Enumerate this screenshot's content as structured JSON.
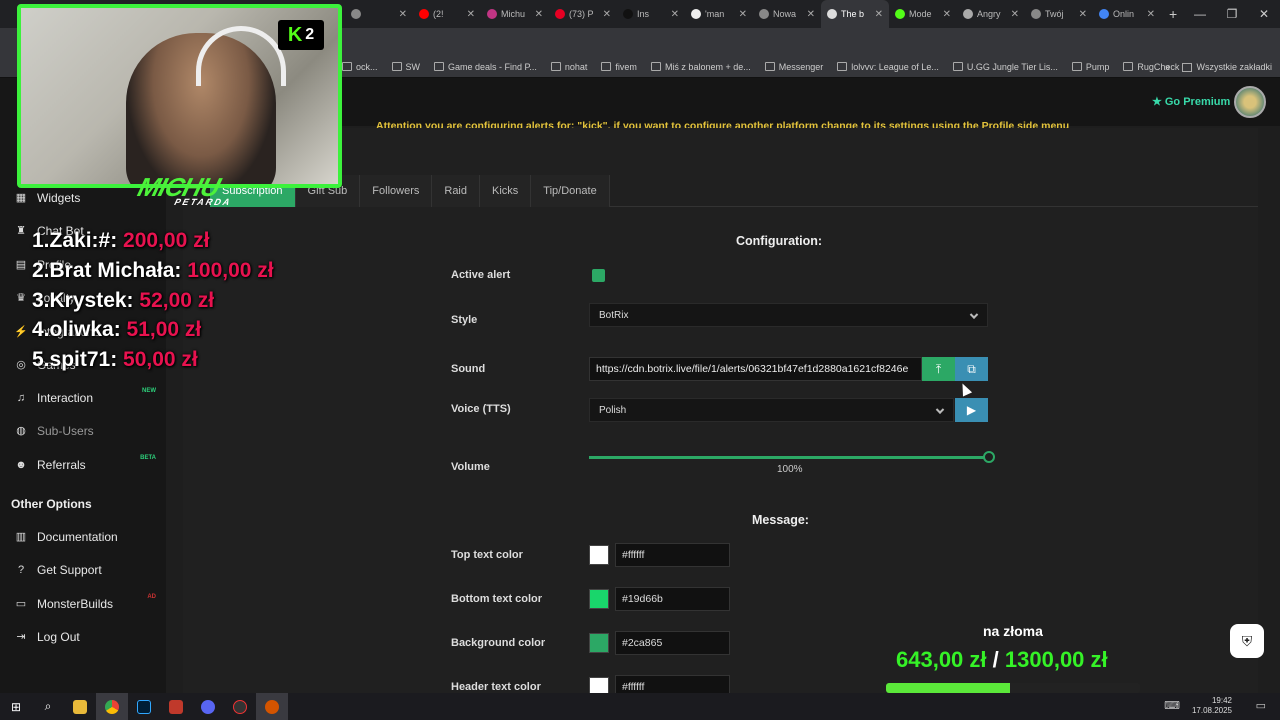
{
  "browser": {
    "tabs": [
      {
        "label": "",
        "color": "#888888"
      },
      {
        "label": "(2!",
        "color": "#ff0000"
      },
      {
        "label": "Michu",
        "color": "#c13584"
      },
      {
        "label": "(73) P",
        "color": "#e60023"
      },
      {
        "label": "Ins",
        "color": "#111111"
      },
      {
        "label": "'man",
        "color": "#eeeeee"
      },
      {
        "label": "Nowa",
        "color": "#888888"
      },
      {
        "label": "The b",
        "color": "#dddddd",
        "active": true
      },
      {
        "label": "Mode",
        "color": "#53fc18"
      },
      {
        "label": "Angry",
        "color": "#aaaaaa"
      },
      {
        "label": "Twój",
        "color": "#888888"
      },
      {
        "label": "Onlin",
        "color": "#4285f4"
      }
    ],
    "new_tab": "+",
    "window_controls": [
      "—",
      "❐",
      "✕"
    ],
    "bookmarks": [
      {
        "label": "ock...",
        "icon": "folder-icon"
      },
      {
        "label": "SW",
        "icon": "folder-icon"
      },
      {
        "label": "Game deals - Find P...",
        "icon": "game-icon"
      },
      {
        "label": "nohat",
        "icon": "smiley-icon"
      },
      {
        "label": "fivem",
        "icon": "folder-icon"
      },
      {
        "label": "Miś z balonem + de...",
        "icon": "doc-icon"
      },
      {
        "label": "Messenger",
        "icon": "messenger-icon"
      },
      {
        "label": "lolvvv: League of Le...",
        "icon": "v-icon"
      },
      {
        "label": "U.GG Jungle Tier Lis...",
        "icon": "ugg-icon"
      },
      {
        "label": "Pump",
        "icon": "pill-icon"
      },
      {
        "label": "RugCheck",
        "icon": "rug-icon"
      }
    ],
    "bookmarks_more": "»",
    "all_bookmarks": "Wszystkie zakładki"
  },
  "app": {
    "attention": "Attention you are configuring alerts for: \"kick\", if you want to configure another platform change to its settings using the Profile side menu",
    "premium": "Go Premium",
    "sidebar": {
      "items": [
        {
          "label": "Widgets",
          "icon": "grid-icon"
        },
        {
          "label": "Chat Bot",
          "icon": "robot-icon"
        },
        {
          "label": "Profile",
          "icon": "id-card-icon"
        },
        {
          "label": "Loyalty",
          "icon": "trophy-icon"
        },
        {
          "label": "Integrations",
          "icon": "plug-icon"
        },
        {
          "label": "Games",
          "icon": "gamepad-icon"
        },
        {
          "label": "Interaction",
          "icon": "music-icon",
          "badge": "NEW"
        },
        {
          "label": "Sub-Users",
          "icon": "users-icon"
        },
        {
          "label": "Referrals",
          "icon": "people-icon",
          "badge": "BETA"
        }
      ],
      "other_heading": "Other Options",
      "other_items": [
        {
          "label": "Documentation",
          "icon": "book-icon"
        },
        {
          "label": "Get Support",
          "icon": "question-icon"
        },
        {
          "label": "MonsterBuilds",
          "icon": "monitor-icon",
          "badge": "AD"
        },
        {
          "label": "Log Out",
          "icon": "logout-icon"
        }
      ]
    },
    "tabs": [
      "Subscription",
      "Gift Sub",
      "Followers",
      "Raid",
      "Kicks",
      "Tip/Donate"
    ],
    "config_title": "Configuration:",
    "active_alert_label": "Active alert",
    "style_label": "Style",
    "style_value": "BotRix",
    "sound_label": "Sound",
    "sound_value": "https://cdn.botrix.live/file/1/alerts/06321bf47ef1d2880a1621cf8246e",
    "voice_label": "Voice (TTS)",
    "voice_value": "Polish",
    "volume_label": "Volume",
    "volume_value": "100%",
    "message_title": "Message:",
    "colors": [
      {
        "label": "Top text color",
        "hex": "#ffffff"
      },
      {
        "label": "Bottom text color",
        "hex": "#19d66b"
      },
      {
        "label": "Background color",
        "hex": "#2ca865"
      },
      {
        "label": "Header text color",
        "hex": "#ffffff"
      }
    ]
  },
  "overlay": {
    "kick_number": "2",
    "logo_text": "MICHU",
    "logo_sub": "PETARDA",
    "donors": [
      {
        "name": "1.Zaki:#:",
        "amount": "200,00 zł"
      },
      {
        "name": "2.Brat Michała:",
        "amount": "100,00 zł"
      },
      {
        "name": "3.Krystek:",
        "amount": "52,00 zł"
      },
      {
        "name": "4.oliwka:",
        "amount": "51,00 zł"
      },
      {
        "name": "5.spit71:",
        "amount": "50,00 zł"
      }
    ],
    "goal_title": "na złoma",
    "goal_current": "643,00 zł",
    "goal_separator": "/",
    "goal_target": "1300,00 zł",
    "goal_progress": 0.49
  },
  "taskbar": {
    "time": "19:42",
    "date": "17.08.2025"
  }
}
